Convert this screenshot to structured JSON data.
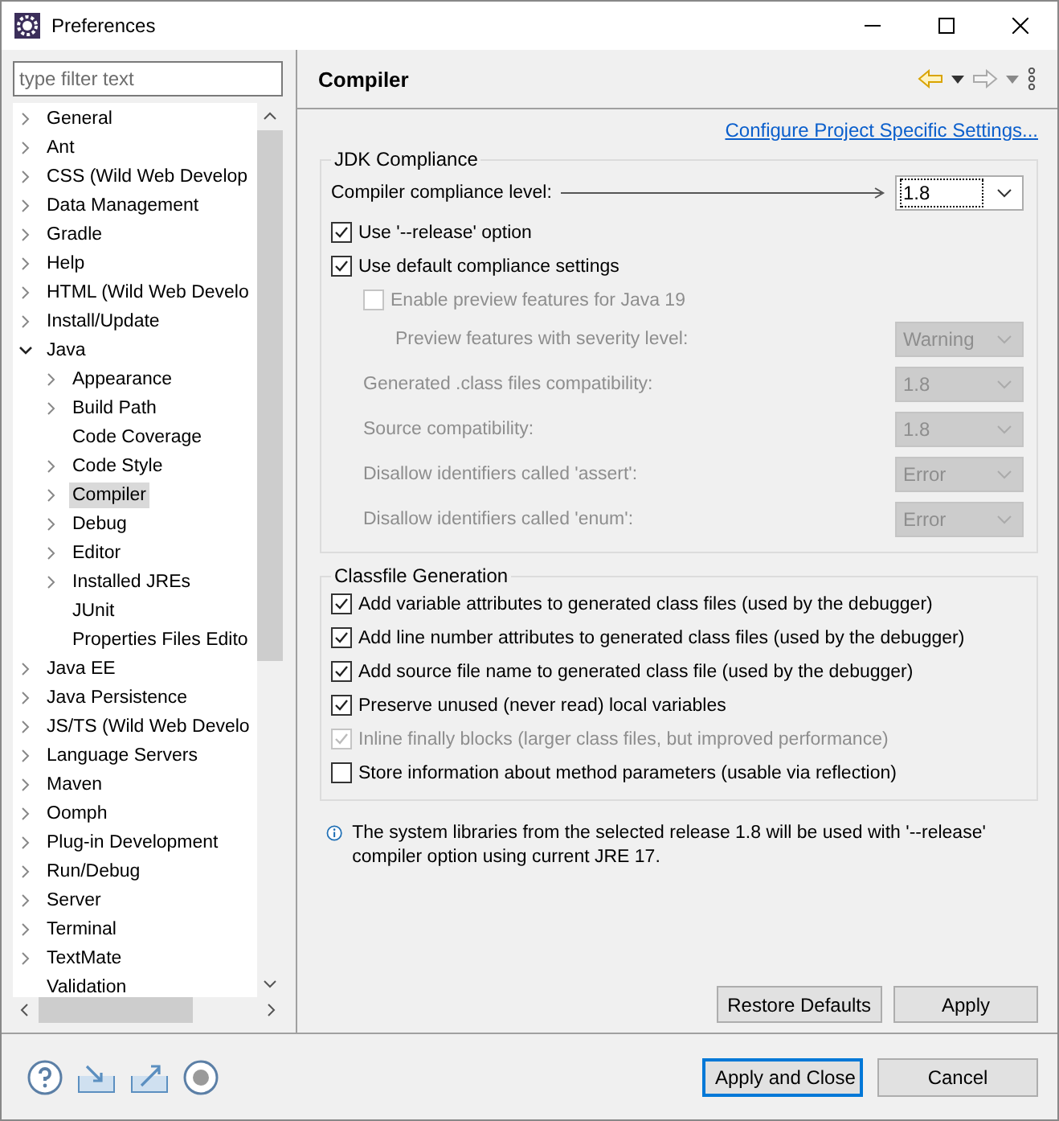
{
  "window": {
    "title": "Preferences"
  },
  "filter": {
    "placeholder": "type filter text"
  },
  "tree": [
    {
      "label": "General",
      "expandable": true,
      "selected": false
    },
    {
      "label": "Ant",
      "expandable": true,
      "selected": false
    },
    {
      "label": "CSS (Wild Web Develop",
      "expandable": true,
      "selected": false
    },
    {
      "label": "Data Management",
      "expandable": true,
      "selected": false
    },
    {
      "label": "Gradle",
      "expandable": true,
      "selected": false
    },
    {
      "label": "Help",
      "expandable": true,
      "selected": false
    },
    {
      "label": "HTML (Wild Web Develo",
      "expandable": true,
      "selected": false
    },
    {
      "label": "Install/Update",
      "expandable": true,
      "selected": false
    },
    {
      "label": "Java",
      "expandable": true,
      "selected": false,
      "children": [
        {
          "label": "Appearance",
          "expandable": true,
          "selected": false
        },
        {
          "label": "Build Path",
          "expandable": true,
          "selected": false
        },
        {
          "label": "Code Coverage",
          "expandable": false,
          "selected": false
        },
        {
          "label": "Code Style",
          "expandable": true,
          "selected": false
        },
        {
          "label": "Compiler",
          "expandable": true,
          "selected": true
        },
        {
          "label": "Debug",
          "expandable": true,
          "selected": false
        },
        {
          "label": "Editor",
          "expandable": true,
          "selected": false
        },
        {
          "label": "Installed JREs",
          "expandable": true,
          "selected": false
        },
        {
          "label": "JUnit",
          "expandable": false,
          "selected": false
        },
        {
          "label": "Properties Files Edito",
          "expandable": false,
          "selected": false
        }
      ]
    },
    {
      "label": "Java EE",
      "expandable": true,
      "selected": false
    },
    {
      "label": "Java Persistence",
      "expandable": true,
      "selected": false
    },
    {
      "label": "JS/TS (Wild Web Develo",
      "expandable": true,
      "selected": false
    },
    {
      "label": "Language Servers",
      "expandable": true,
      "selected": false
    },
    {
      "label": "Maven",
      "expandable": true,
      "selected": false
    },
    {
      "label": "Oomph",
      "expandable": true,
      "selected": false
    },
    {
      "label": "Plug-in Development",
      "expandable": true,
      "selected": false
    },
    {
      "label": "Run/Debug",
      "expandable": true,
      "selected": false
    },
    {
      "label": "Server",
      "expandable": true,
      "selected": false
    },
    {
      "label": "Terminal",
      "expandable": true,
      "selected": false
    },
    {
      "label": "TextMate",
      "expandable": true,
      "selected": false
    },
    {
      "label": "Validation",
      "expandable": false,
      "selected": false
    }
  ],
  "page": {
    "title": "Compiler",
    "link": "Configure Project Specific Settings...",
    "groups": [
      {
        "title": "JDK Compliance",
        "rows": [
          {
            "kind": "combo",
            "label": "Compiler compliance level:",
            "value": "1.8",
            "disabled": false,
            "focused": true,
            "leader": true
          },
          {
            "kind": "check",
            "label": "Use '--release' option",
            "checked": true,
            "disabled": false
          },
          {
            "kind": "check",
            "label": "Use default compliance settings",
            "checked": true,
            "disabled": false,
            "children": [
              {
                "kind": "check",
                "label": "Enable preview features for Java 19",
                "checked": false,
                "disabled": true,
                "children": [
                  {
                    "kind": "combo",
                    "label": "Preview features with severity level:",
                    "value": "Warning",
                    "disabled": true,
                    "focused": false,
                    "leader": false
                  }
                ]
              },
              {
                "kind": "combo",
                "label": "Generated .class files compatibility:",
                "value": "1.8",
                "disabled": true,
                "focused": false,
                "leader": false
              },
              {
                "kind": "combo",
                "label": "Source compatibility:",
                "value": "1.8",
                "disabled": true,
                "focused": false,
                "leader": false
              },
              {
                "kind": "combo",
                "label": "Disallow identifiers called 'assert':",
                "value": "Error",
                "disabled": true,
                "focused": false,
                "leader": false
              },
              {
                "kind": "combo",
                "label": "Disallow identifiers called 'enum':",
                "value": "Error",
                "disabled": true,
                "focused": false,
                "leader": false
              }
            ]
          }
        ]
      },
      {
        "title": "Classfile Generation",
        "rows": [
          {
            "kind": "check",
            "label": "Add variable attributes to generated class files (used by the debugger)",
            "checked": true,
            "disabled": false
          },
          {
            "kind": "check",
            "label": "Add line number attributes to generated class files (used by the debugger)",
            "checked": true,
            "disabled": false
          },
          {
            "kind": "check",
            "label": "Add source file name to generated class file (used by the debugger)",
            "checked": true,
            "disabled": false
          },
          {
            "kind": "check",
            "label": "Preserve unused (never read) local variables",
            "checked": true,
            "disabled": false
          },
          {
            "kind": "check",
            "label": "Inline finally blocks (larger class files, but improved performance)",
            "checked": true,
            "disabled": true
          },
          {
            "kind": "check",
            "label": "Store information about method parameters (usable via reflection)",
            "checked": false,
            "disabled": false
          }
        ]
      }
    ],
    "note": "The system libraries from the selected release 1.8 will be used with '--release' compiler option using current JRE 17.",
    "buttons": [
      {
        "label": "Restore Defaults"
      },
      {
        "label": "Apply"
      }
    ]
  },
  "dialog_buttons": [
    {
      "label": "Apply and Close",
      "default": true
    },
    {
      "label": "Cancel",
      "default": false
    }
  ]
}
